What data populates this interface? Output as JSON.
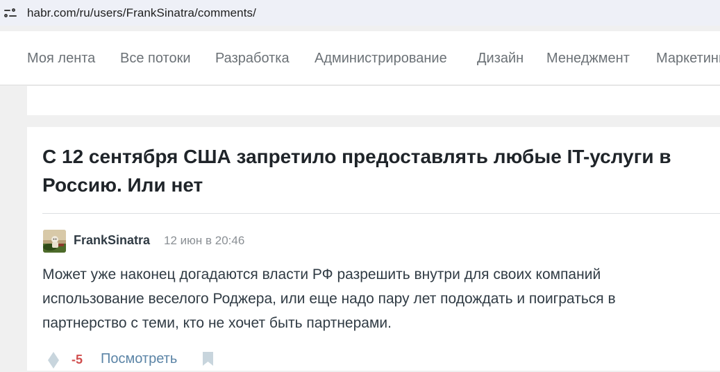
{
  "browser": {
    "url": "habr.com/ru/users/FrankSinatra/comments/",
    "site_settings_icon": "tune-icon"
  },
  "nav": {
    "items": [
      {
        "label": "Моя лента"
      },
      {
        "label": "Все потоки"
      },
      {
        "label": "Разработка"
      },
      {
        "label": "Администрирование"
      },
      {
        "label": "Дизайн"
      },
      {
        "label": "Менеджмент"
      },
      {
        "label": "Маркетинг"
      }
    ]
  },
  "post": {
    "title": "С 12 сентября США запретило предоставлять любые IT-услуги в Россию. Или нет"
  },
  "comment": {
    "author": "FrankSinatra",
    "timestamp": "12 июн в 20:46",
    "text": "Может уже наконец догадаются власти РФ разрешить внутри для своих компаний использование веселого Роджера, или еще надо пару лет подождать и поиграться в партнерство с теми, кто не хочет быть партнерами.",
    "score": "-5",
    "view_label": "Посмотреть",
    "icons": {
      "vote": "vote-diamond-icon",
      "bookmark": "bookmark-icon"
    }
  },
  "colors": {
    "score_negative": "#d04e4e",
    "link": "#5b84a6",
    "nav_text": "#6b7176",
    "title": "#1f2429"
  }
}
